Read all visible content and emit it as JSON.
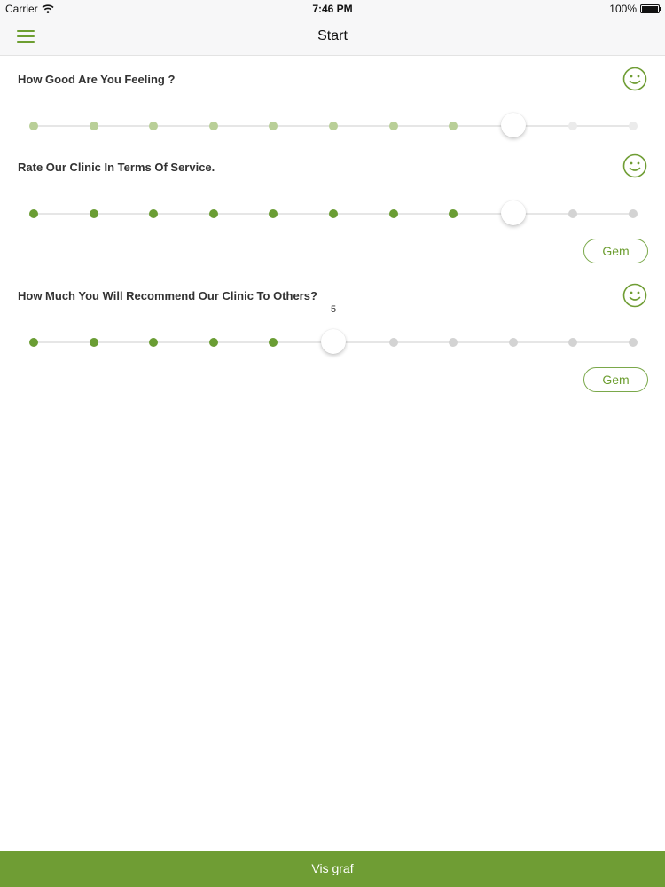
{
  "status_bar": {
    "carrier": "Carrier",
    "time": "7:46 PM",
    "battery": "100%"
  },
  "nav": {
    "title": "Start",
    "menu_icon": "hamburger-menu-icon"
  },
  "colors": {
    "accent": "#6f9d34",
    "accent_light": "#b9cf98",
    "inactive_dot": "#d3d3d3"
  },
  "questions": [
    {
      "text": "How Good Are You Feeling ?",
      "icon": "smiley-icon",
      "scale_points": 11,
      "value": 8,
      "dim": true
    },
    {
      "text": "Rate Our Clinic In Terms Of Service.",
      "icon": "smiley-icon",
      "scale_points": 11,
      "value": 8,
      "save_label": "Gem"
    },
    {
      "text": "How Much You Will Recommend Our Clinic To Others?",
      "icon": "smiley-icon",
      "scale_points": 11,
      "value": 5,
      "value_label": "5",
      "save_label": "Gem"
    }
  ],
  "bottom_bar": {
    "label": "Vis graf"
  }
}
